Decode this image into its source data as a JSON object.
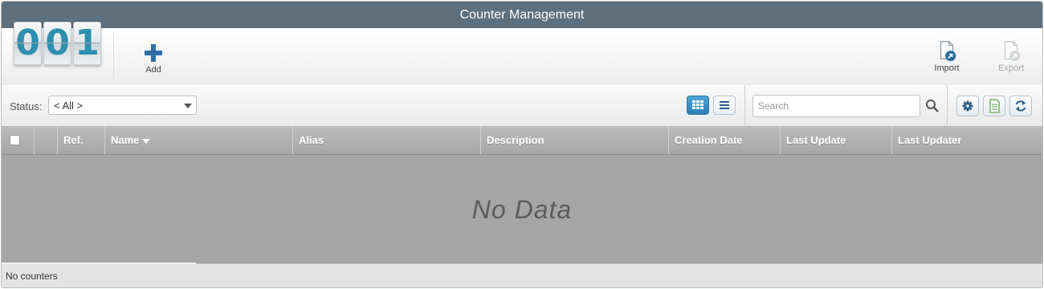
{
  "window": {
    "title": "Counter Management"
  },
  "logo": {
    "digits": [
      "0",
      "0",
      "1"
    ]
  },
  "toolbar": {
    "add_label": "Add",
    "import_label": "Import",
    "export_label": "Export"
  },
  "filter": {
    "status_label": "Status:",
    "status_value": "< All >",
    "search_placeholder": "Search"
  },
  "grid": {
    "columns": [
      "Ref.",
      "Name",
      "Alias",
      "Description",
      "Creation Date",
      "Last Update",
      "Last Updater"
    ],
    "sorted_column": "Name",
    "empty_text": "No Data"
  },
  "statusbar": {
    "text": "No counters"
  },
  "colors": {
    "titlebar": "#5e6f7d",
    "accent": "#2f8fae",
    "active_view": "#2a7fb6"
  },
  "icons": [
    "plus-icon",
    "import-icon",
    "export-icon",
    "grid-view-icon",
    "list-view-icon",
    "search-icon",
    "gear-icon",
    "spreadsheet-icon",
    "refresh-icon"
  ]
}
